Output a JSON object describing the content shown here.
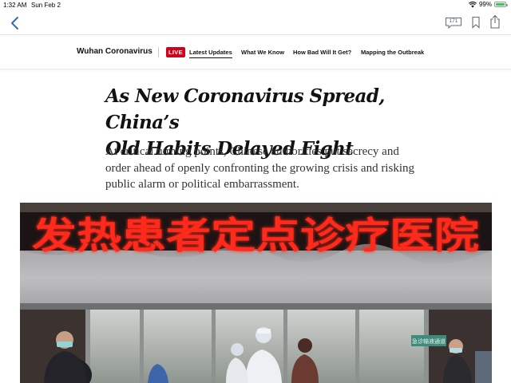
{
  "status_bar": {
    "time": "1:32 AM",
    "date": "Sun Feb 2",
    "battery_percent": "99%",
    "battery_level": 0.99
  },
  "toolbar": {
    "comment_count": "171"
  },
  "nav": {
    "section": "Wuhan Coronavirus",
    "live_badge": "LIVE",
    "links": [
      "Latest Updates",
      "What We Know",
      "How Bad Will It Get?",
      "Mapping the Outbreak"
    ]
  },
  "article": {
    "headline_line1": "As New Coronavirus Spread, China’s",
    "headline_line2": "Old Habits Delayed Fight",
    "summary": "At critical turning points, Chinese authorities put secrecy and order ahead of openly confronting the growing crisis and risking public alarm or political embarrassment."
  },
  "photo": {
    "sign_text": "发热患者定点诊疗医院",
    "sign_color": "#ff2a1a",
    "door_sign": "急诊输液通道"
  }
}
